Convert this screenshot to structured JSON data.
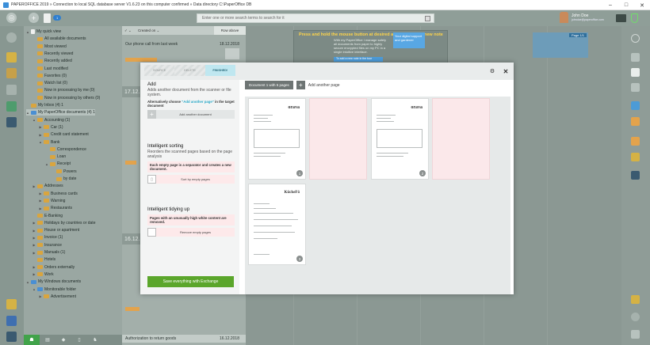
{
  "window": {
    "title": "PAPEROFFICE 2019 » Connection to local SQL database server V1.6.23 on this computer confirmed » Data directory C:\\PaperOffice DB",
    "minimize": "–",
    "maximize": "□",
    "close": "✕"
  },
  "toolbar": {
    "doc_badge": "1",
    "search_placeholder": "Enter one or more search terms to search for it",
    "user_name": "John Doe",
    "user_email": "johndoe@paperoffice.com"
  },
  "tree": {
    "items": [
      {
        "label": "My quick view",
        "indent": 0,
        "icon": "page",
        "toggle": "▲"
      },
      {
        "label": "All available documents",
        "indent": 1,
        "icon": "folder",
        "toggle": ""
      },
      {
        "label": "Most viewed",
        "indent": 1,
        "icon": "folder",
        "toggle": ""
      },
      {
        "label": "Recently viewed",
        "indent": 1,
        "icon": "folder",
        "toggle": ""
      },
      {
        "label": "Recently added",
        "indent": 1,
        "icon": "folder",
        "toggle": ""
      },
      {
        "label": "Last modified",
        "indent": 1,
        "icon": "folder",
        "toggle": ""
      },
      {
        "label": "Favorites (0)",
        "indent": 1,
        "icon": "folder",
        "toggle": ""
      },
      {
        "label": "Watch list (0)",
        "indent": 1,
        "icon": "folder",
        "toggle": ""
      },
      {
        "label": "Now in processing by me (0)",
        "indent": 1,
        "icon": "folder",
        "toggle": ""
      },
      {
        "label": "Now in processing by others (0)",
        "indent": 1,
        "icon": "folder",
        "toggle": ""
      },
      {
        "label": "My Inbox (4) 1",
        "indent": 0,
        "icon": "folder",
        "toggle": ""
      },
      {
        "label": "My PaperOffice documents (4) 1",
        "indent": 0,
        "icon": "blue",
        "toggle": "▲"
      },
      {
        "label": "Accounting (1)",
        "indent": 1,
        "icon": "folder",
        "toggle": "▲"
      },
      {
        "label": "Car (1)",
        "indent": 2,
        "icon": "folder",
        "toggle": "▶"
      },
      {
        "label": "Credit card statement",
        "indent": 2,
        "icon": "folder",
        "toggle": "▶"
      },
      {
        "label": "Bank",
        "indent": 2,
        "icon": "folder",
        "toggle": "▲"
      },
      {
        "label": "Correspondence",
        "indent": 3,
        "icon": "folder",
        "toggle": ""
      },
      {
        "label": "Loan",
        "indent": 3,
        "icon": "folder",
        "toggle": ""
      },
      {
        "label": "Receipt",
        "indent": 3,
        "icon": "folder",
        "toggle": "▲"
      },
      {
        "label": "Powers",
        "indent": 4,
        "icon": "folder",
        "toggle": ""
      },
      {
        "label": "by date",
        "indent": 4,
        "icon": "folder",
        "toggle": ""
      },
      {
        "label": "Addresses",
        "indent": 1,
        "icon": "folder",
        "toggle": "▶"
      },
      {
        "label": "Business cards",
        "indent": 2,
        "icon": "folder",
        "toggle": "▶"
      },
      {
        "label": "Warning",
        "indent": 2,
        "icon": "folder",
        "toggle": "▶"
      },
      {
        "label": "Restaurants",
        "indent": 2,
        "icon": "folder",
        "toggle": "▶"
      },
      {
        "label": "E-Banking",
        "indent": 1,
        "icon": "folder",
        "toggle": ""
      },
      {
        "label": "Holidays by countries or date",
        "indent": 1,
        "icon": "folder",
        "toggle": "▶"
      },
      {
        "label": "House or apartment",
        "indent": 1,
        "icon": "folder",
        "toggle": "▶"
      },
      {
        "label": "Invoice (1)",
        "indent": 1,
        "icon": "folder",
        "toggle": "▶"
      },
      {
        "label": "Insurance",
        "indent": 1,
        "icon": "folder",
        "toggle": "▶"
      },
      {
        "label": "Manuals (1)",
        "indent": 1,
        "icon": "folder",
        "toggle": "▶"
      },
      {
        "label": "Hotels",
        "indent": 1,
        "icon": "folder",
        "toggle": ""
      },
      {
        "label": "Orders externally",
        "indent": 1,
        "icon": "folder",
        "toggle": "▶"
      },
      {
        "label": "Work",
        "indent": 1,
        "icon": "folder",
        "toggle": "▶"
      },
      {
        "label": "My Windows documents",
        "indent": 0,
        "icon": "blue",
        "toggle": "▲"
      },
      {
        "label": "Monitorable folder",
        "indent": 1,
        "icon": "blue",
        "toggle": "▲"
      },
      {
        "label": "Advertisement",
        "indent": 2,
        "icon": "folder",
        "toggle": "▶"
      }
    ]
  },
  "doclist": {
    "col_sort": "Created on ⌄",
    "col_view": "Row above",
    "rows": [
      {
        "title": "Our phone call from last week",
        "date": "18.12.2018"
      }
    ],
    "group_headers": [
      "17.12.",
      "16.12."
    ],
    "bottom_row": {
      "title": "Authorization to return goods",
      "date": "16.12.2018"
    }
  },
  "tooltip": {
    "title": "Press and hold the mouse button at desired area to create a new note",
    "body": "With my PaperOffice I manage safely all documents from paper to highly secure encrypted files on my PC in a single intuitive interface.",
    "cta": "To add a new note in the tour",
    "promo": "Your digital support and gardener"
  },
  "preview_label": "Page 1/1",
  "modal": {
    "steps": [
      "SOURCE",
      "DELETE",
      "FINISHED!"
    ],
    "add": {
      "title": "Add",
      "text": "Adds another document from the scanner or file system.",
      "note_prefix": "Alternatively choose ",
      "note_highlight": "\"Add another page\"",
      "note_suffix": " in the target document",
      "button": "Add another document"
    },
    "sorting": {
      "title": "Intelligent sorting",
      "text": "Reorders the scanned pages based on the page analysis",
      "note": "Each empty page is a separator and creates a new document.",
      "button": "Sort by empty pages"
    },
    "tidying": {
      "title": "Intelligent tidying up",
      "note": "Pages with an unusually high white content are removed.",
      "button": "Remove empty pages"
    },
    "save_button": "Save everything with Exchange",
    "doc_tab": "Document 1 with 5 pages",
    "add_page": "Add another page",
    "pages": [
      {
        "num": "1",
        "logo": "orava",
        "empty": false
      },
      {
        "num": "",
        "logo": "",
        "empty": true
      },
      {
        "num": "2",
        "logo": "orava",
        "empty": false
      },
      {
        "num": "",
        "logo": "",
        "empty": true
      },
      {
        "num": "3",
        "logo": "KücheFö",
        "empty": false
      }
    ],
    "close": "✕",
    "settings": "⚙"
  },
  "colors": {
    "accent_green": "#5ba62b",
    "accent_blue": "#2f7fd0",
    "step_active": "#bfe7f0",
    "empty_page": "#fbe8ea"
  }
}
